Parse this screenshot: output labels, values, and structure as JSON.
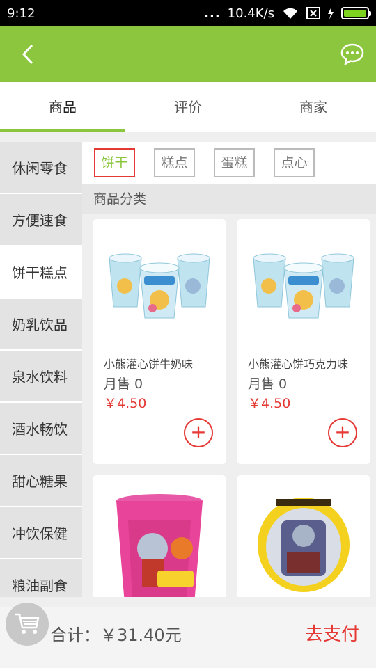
{
  "status": {
    "time": "9:12",
    "dots": "...",
    "speed": "10.4K/s",
    "icons": [
      "wifi-icon",
      "sim-icon",
      "charging-icon",
      "battery-icon"
    ]
  },
  "appbar": {
    "icons": [
      "back-arrow-icon",
      "chat-bubble-icon"
    ]
  },
  "tabs": [
    {
      "label": "商品"
    },
    {
      "label": "评价"
    },
    {
      "label": "商家"
    }
  ],
  "sidebar": {
    "items": [
      {
        "label": "休闲零食"
      },
      {
        "label": "方便速食"
      },
      {
        "label": "饼干糕点"
      },
      {
        "label": "奶乳饮品"
      },
      {
        "label": "泉水饮料"
      },
      {
        "label": "酒水畅饮"
      },
      {
        "label": "甜心糖果"
      },
      {
        "label": "冲饮保健"
      },
      {
        "label": "粮油副食"
      }
    ]
  },
  "subtabs": [
    {
      "label": "饼干"
    },
    {
      "label": "糕点"
    },
    {
      "label": "蛋糕"
    },
    {
      "label": "点心"
    }
  ],
  "section_title": "商品分类",
  "products": [
    {
      "name": "小熊灌心饼牛奶味",
      "sales": "月售 0",
      "price": "￥4.50"
    },
    {
      "name": "小熊灌心饼巧克力味",
      "sales": "月售 0",
      "price": "￥4.50"
    },
    {
      "name": "",
      "sales": "",
      "price": ""
    },
    {
      "name": "",
      "sales": "",
      "price": ""
    }
  ],
  "cart": {
    "total": "合计：￥31.40元",
    "pay_label": "去支付"
  },
  "colors": {
    "brand_green": "#8cc63e",
    "accent_red": "#e53935"
  }
}
